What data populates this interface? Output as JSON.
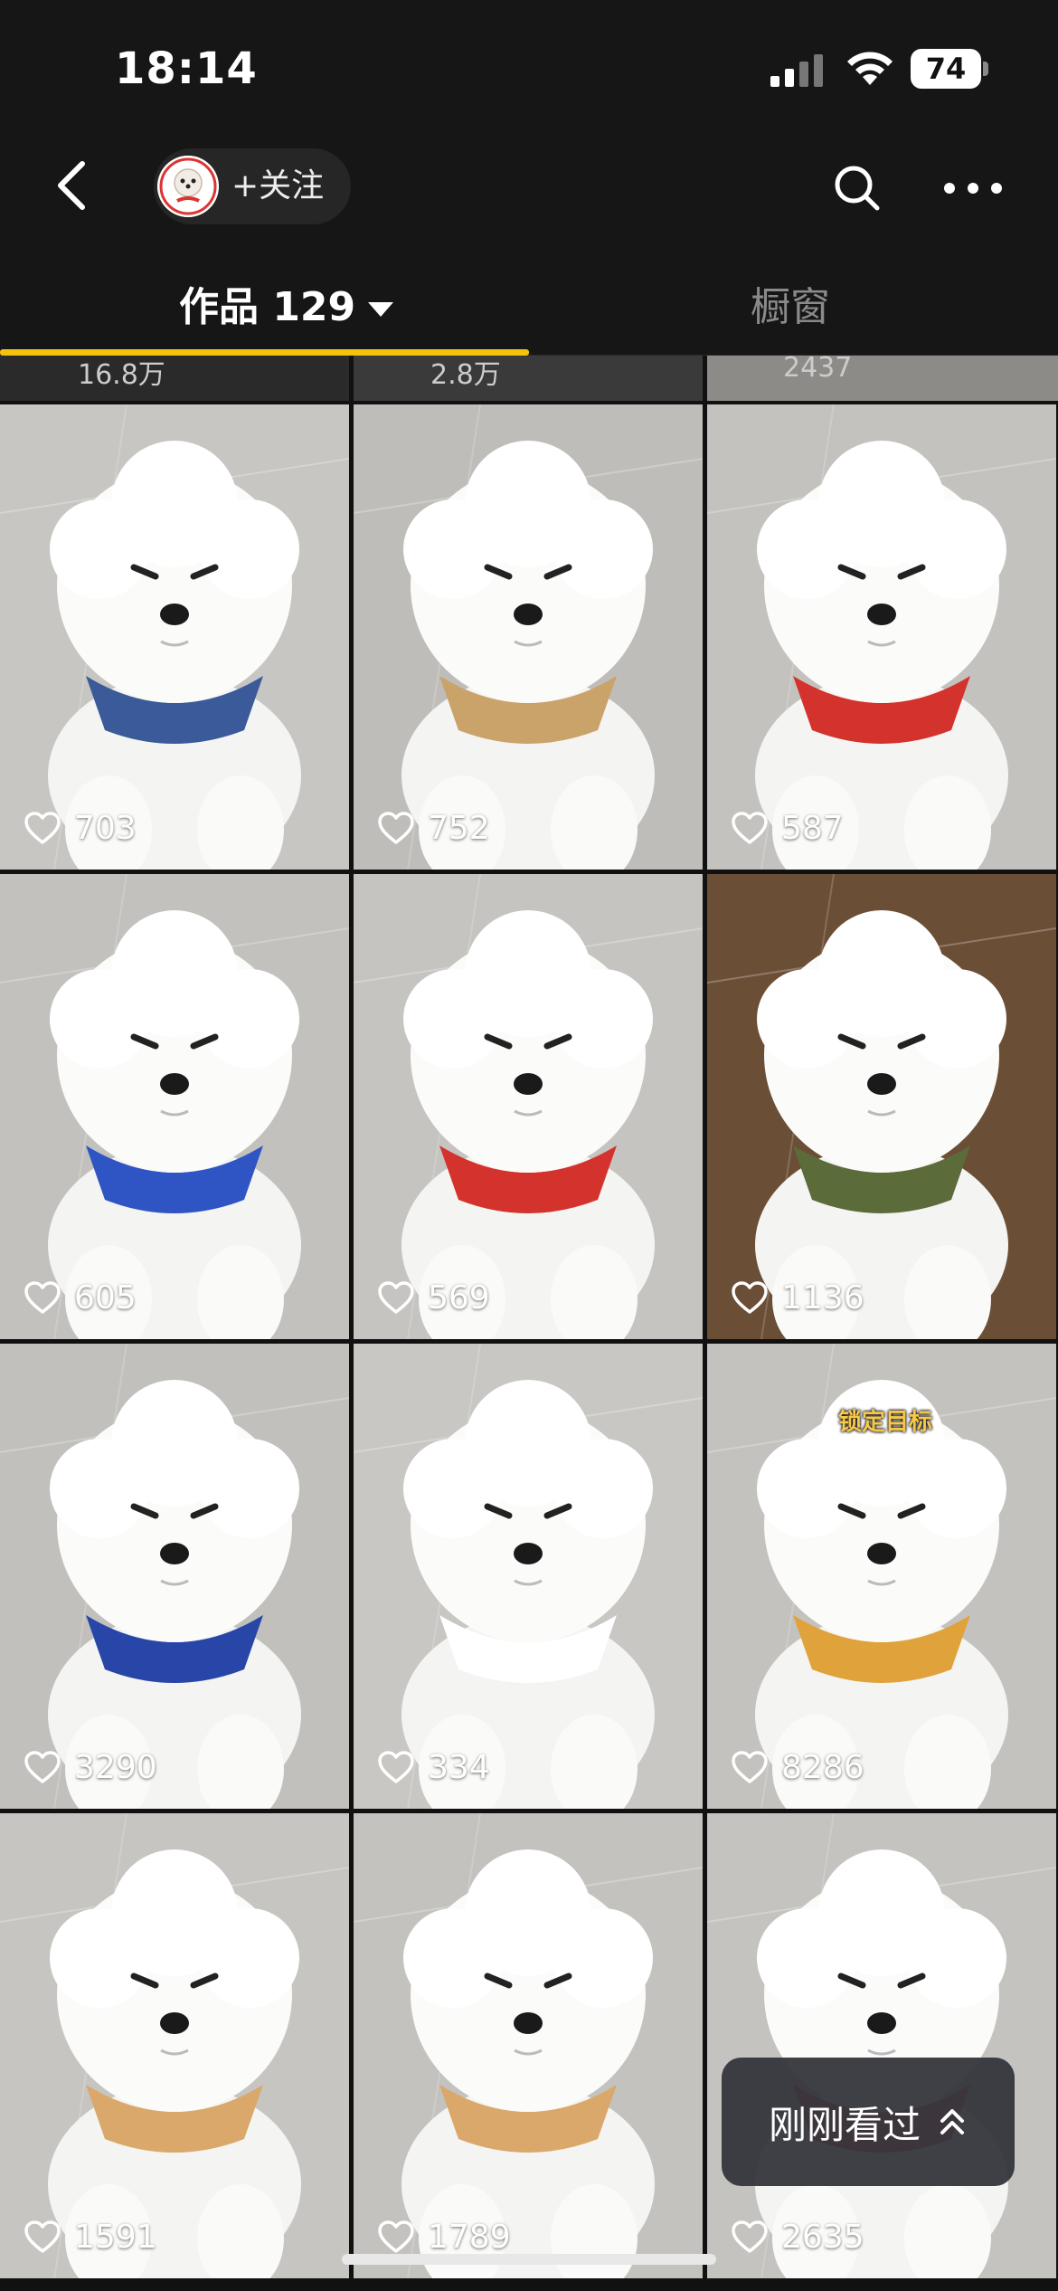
{
  "status_bar": {
    "time": "18:14",
    "battery": "74",
    "signal_icon": "signal-icon",
    "wifi_icon": "wifi-icon"
  },
  "nav": {
    "back_icon": "chevron-left-icon",
    "follow_label": "+关注",
    "search_icon": "search-icon",
    "more_icon": "more-icon"
  },
  "tabs": {
    "works_label": "作品 129",
    "shop_label": "橱窗"
  },
  "top_strip": {
    "likes": [
      "16.8万",
      "2.8万",
      "2437"
    ]
  },
  "grid": {
    "cells": [
      {
        "likes": "703"
      },
      {
        "likes": "752"
      },
      {
        "likes": "587"
      },
      {
        "likes": "605"
      },
      {
        "likes": "569"
      },
      {
        "likes": "1136"
      },
      {
        "likes": "3290"
      },
      {
        "likes": "334"
      },
      {
        "likes": "8286",
        "caption": "锁定目标"
      },
      {
        "likes": "1591"
      },
      {
        "likes": "1789"
      },
      {
        "likes": "2635"
      }
    ]
  },
  "recent_button": {
    "label": "刚刚看过",
    "icon": "chevrons-up-icon"
  },
  "colors": {
    "accent": "#f4c20d",
    "background": "#161616"
  }
}
